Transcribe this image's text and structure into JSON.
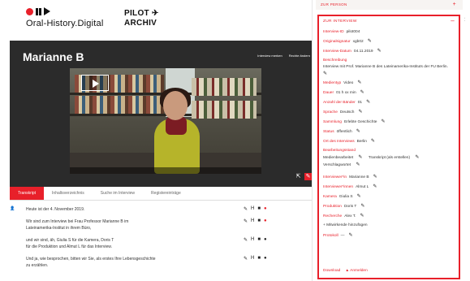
{
  "header": {
    "logo_text": "Oral-History.Digital",
    "pilot_line1": "PILOT",
    "pilot_plane": "✈",
    "pilot_line2": "ARCHIV"
  },
  "video": {
    "person_name": "Marianne B",
    "top_link_1": "Interview merken",
    "top_link_2": "Rechte ändern"
  },
  "tabs": [
    {
      "label": "Transkript",
      "active": true
    },
    {
      "label": "Inhaltsverzeichnis",
      "active": false
    },
    {
      "label": "Suche im Interview",
      "active": false
    },
    {
      "label": "Registereinträge",
      "active": false
    }
  ],
  "transcript": [
    {
      "text": "Heute ist der 4. November 2019.",
      "lines": [
        "Heute ist der 4. November 2019."
      ]
    },
    {
      "lines": [
        "Wir sind zum Interview bei Frau Professor Marianne B     im",
        "Lateinamerika-Institut in ihrem Büro,"
      ]
    },
    {
      "lines": [
        "und wir sind, äh, Giulia S          für die Kamera, Doris T",
        "für die Produktion und Almut L     für das Interview."
      ]
    },
    {
      "lines": [
        "Und ja, wie besprochen, bitten wir Sie, als erstes Ihre Lebensgeschichte",
        "zu erzählen."
      ]
    }
  ],
  "right_panel": {
    "zur_person": "ZUR PERSON",
    "zur_person_plus": "+",
    "close": "›",
    "interview_title": "ZUR INTERVIEW",
    "interview_minus": "–",
    "fields": {
      "archiv_id_lbl": "Interview-ID",
      "archiv_id_val": "pilot004",
      "originalsignatur_lbl": "Originalsignatur",
      "originalsignatur_val": "xgb02",
      "datum_lbl": "Interview-Datum",
      "datum_val": "04.11.2019",
      "beschreibung_lbl": "Beschreibung",
      "beschreibung_val": "Interview mit Prof. Marianne B           des Lateinamerika-Instituts der FU Berlin.",
      "medientyp_lbl": "Medientyp",
      "medientyp_val": "Video",
      "dauer_lbl": "Dauer",
      "dauer_val": "01 h xx min",
      "anzahl_lbl": "Anzahl der Bänder",
      "anzahl_val": "01",
      "sprache_lbl": "Sprache",
      "sprache_val": "Deutsch",
      "sammlung_lbl": "Sammlung",
      "sammlung_val": "Erlebte Geschichte",
      "status_lbl": "Status",
      "status_val": "öffentlich",
      "ort_lbl": "Ort des Interviews",
      "ort_val": "Berlin",
      "bearbeitung_lbl": "Bearbeitungsstand",
      "bearbeitung_val_1": "Medienbearbeitet",
      "bearbeitung_val_2": "Transkript (als erstellen)",
      "bearbeitung_val_3": "Verschlagwortet",
      "interviewer_lbl": "Interviewer*in",
      "interviewer_val": "Marianne B",
      "interviewerin_lbl": "Interviewer*innen",
      "interviewerin_val": "Almut L",
      "kamera_lbl": "Kamera",
      "kamera_val": "Giulia S",
      "produktion_lbl": "Produktion",
      "produktion_val": "Doris T",
      "forschung_lbl": "Recherche",
      "forschung_val": "Alex T.",
      "add_line": "+ Mitwirkende hinzufügen",
      "protokoll_lbl": "Protokoll",
      "protokoll_val": "—"
    },
    "footer_1": "Download",
    "footer_2": "▲ Anmelden"
  }
}
